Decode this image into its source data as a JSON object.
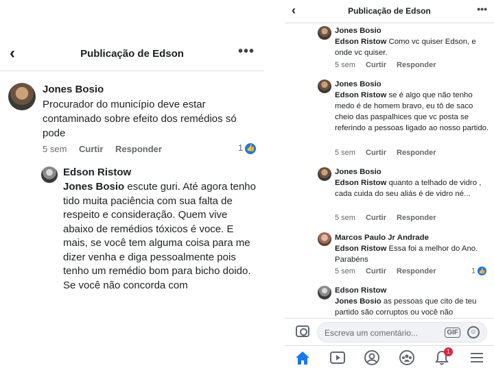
{
  "left": {
    "header": {
      "title": "Publicação de Edson",
      "more": "•••"
    },
    "comment1": {
      "name": "Jones Bosio",
      "text": "Procurador do município deve estar contaminado sobre efeito dos remédios só pode",
      "time": "5 sem",
      "like": "Curtir",
      "reply": "Responder",
      "reactions": "1"
    },
    "comment2": {
      "name": "Edson Ristow",
      "mention": "Jones Bosio",
      "text": " escute guri. Até agora tenho tido muita paciência com sua falta de respeito e consideração. Quem vive abaixo de remédios tóxicos é voce. E mais, se você tem alguma coisa para me dizer venha e diga pessoalmente pois tenho um remédio bom para bicho doido. Se você não concorda com"
    }
  },
  "right": {
    "header": {
      "title": "Publicação de Edson",
      "more": "•••"
    },
    "comments": [
      {
        "name": "Jones Bosio",
        "mention": "Edson Ristow",
        "text": " Como vc quiser Edson, e onde vc quiser.",
        "time": "5 sem",
        "like": "Curtir",
        "reply": "Responder"
      },
      {
        "name": "Jones Bosio",
        "mention": "Edson Ristow",
        "text": " se é algo que não tenho medo é de homem bravo,  eu tô de saco cheio das paspalhices que vc posta se referindo a pessoas ligado ao nosso partido.",
        "time": "5 sem",
        "like": "Curtir",
        "reply": "Responder"
      },
      {
        "name": "Jones Bosio",
        "mention": "Edson Ristow",
        "text": " quanto a telhado de vidro , cada cuida do seu aliás é de vidro né...",
        "time": "5 sem",
        "like": "Curtir",
        "reply": "Responder"
      },
      {
        "name": "Marcos Paulo Jr Andrade",
        "mention": "Edson Ristow",
        "text": " Essa foi a melhor do Ano. Parabéns",
        "time": "5 sem",
        "like": "Curtir",
        "reply": "Responder",
        "reactions": "1"
      },
      {
        "name": "Edson Ristow",
        "mention": "Jones Bosio",
        "text": " as pessoas que cito de teu partido são corruptos ou você não"
      }
    ],
    "composer": {
      "placeholder": "Escreva um comentário...",
      "gif": "GIF"
    },
    "tabbar": {
      "notifications_badge": "1"
    }
  }
}
